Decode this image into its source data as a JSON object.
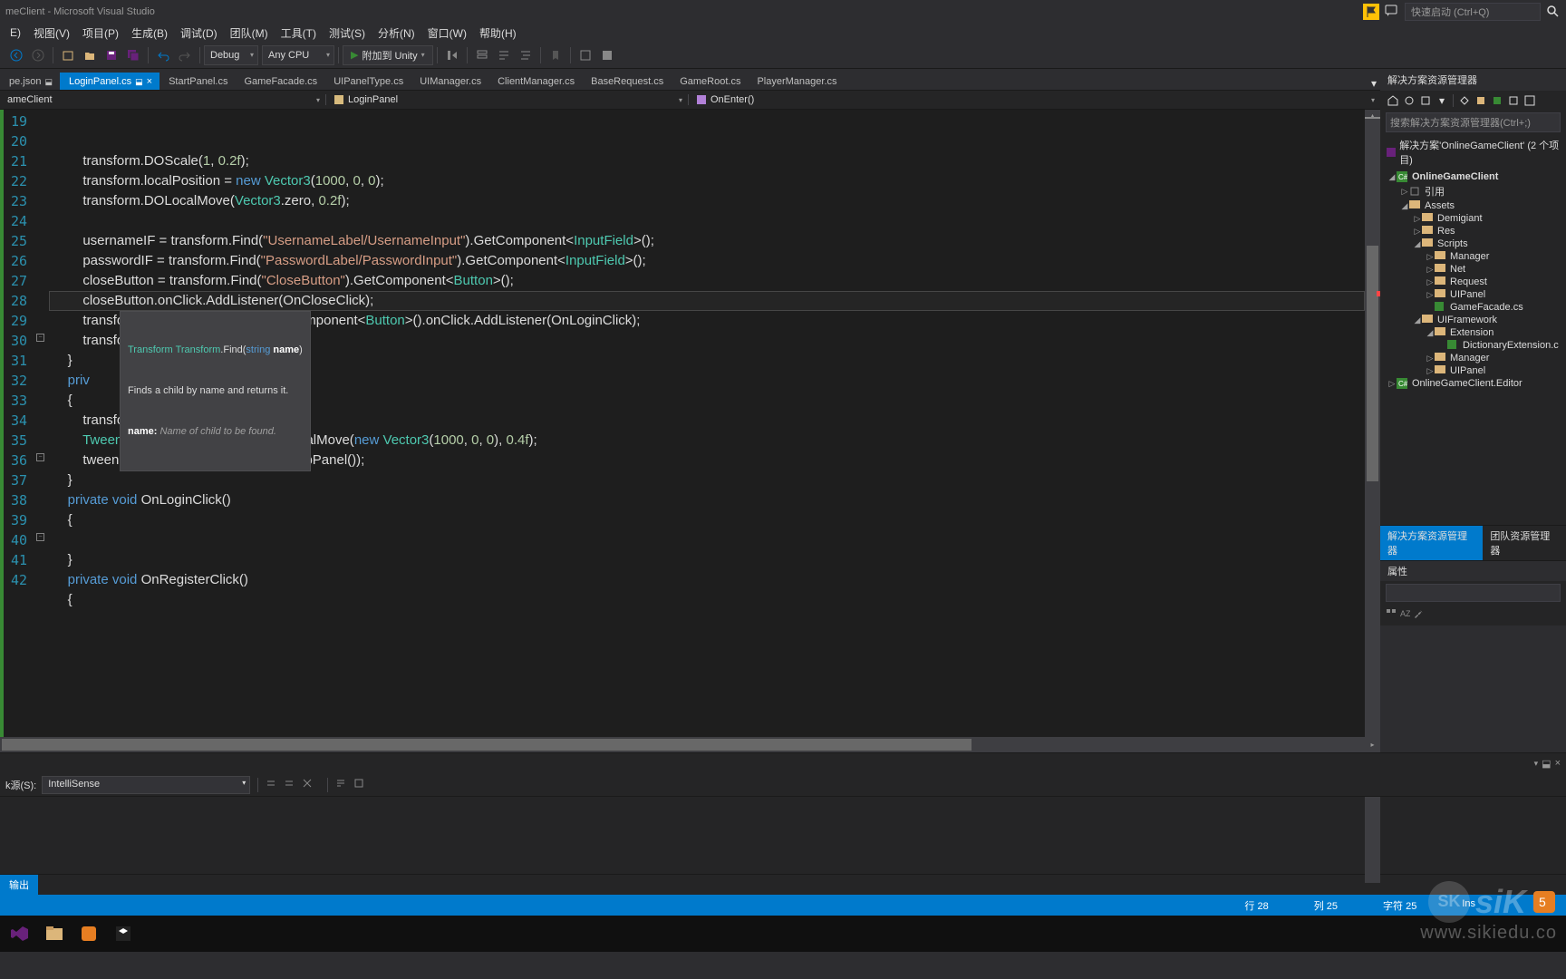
{
  "title": "meClient - Microsoft Visual Studio",
  "quickLaunch": "快速启动 (Ctrl+Q)",
  "menu": [
    "E)",
    "视图(V)",
    "项目(P)",
    "生成(B)",
    "调试(D)",
    "团队(M)",
    "工具(T)",
    "测试(S)",
    "分析(N)",
    "窗口(W)",
    "帮助(H)"
  ],
  "toolbar": {
    "debug": "Debug",
    "cpu": "Any CPU",
    "attach": "附加到 Unity"
  },
  "tabs": [
    {
      "label": "pe.json",
      "pinned": true,
      "active": false
    },
    {
      "label": "LoginPanel.cs",
      "pinned": true,
      "active": true
    },
    {
      "label": "StartPanel.cs",
      "active": false
    },
    {
      "label": "GameFacade.cs",
      "active": false
    },
    {
      "label": "UIPanelType.cs",
      "active": false
    },
    {
      "label": "UIManager.cs",
      "active": false
    },
    {
      "label": "ClientManager.cs",
      "active": false
    },
    {
      "label": "BaseRequest.cs",
      "active": false
    },
    {
      "label": "GameRoot.cs",
      "active": false
    },
    {
      "label": "PlayerManager.cs",
      "active": false
    }
  ],
  "navLeft": "ameClient",
  "navMid": "LoginPanel",
  "navRight": "OnEnter()",
  "lineStart": 19,
  "lineEnd": 42,
  "tooltip": {
    "sig_pre": "Transform",
    "sig_cls": "Transform",
    "sig_method": ".Find(",
    "sig_ptype": "string",
    "sig_pname": "name",
    "sig_post": ")",
    "desc": "Finds a child by name and returns it.",
    "pname": "name:",
    "pdesc": "Name of child to be found."
  },
  "solutionExplorer": {
    "title": "解决方案资源管理器",
    "search": "搜索解决方案资源管理器(Ctrl+;)",
    "solution": "解决方案'OnlineGameClient' (2 个项目)",
    "tree": [
      {
        "d": 0,
        "t": "proj",
        "l": "OnlineGameClient",
        "exp": true,
        "bold": true
      },
      {
        "d": 1,
        "t": "ref",
        "l": "引用",
        "exp": false
      },
      {
        "d": 1,
        "t": "folder",
        "l": "Assets",
        "exp": true
      },
      {
        "d": 2,
        "t": "folder",
        "l": "Demigiant",
        "exp": false
      },
      {
        "d": 2,
        "t": "folder",
        "l": "Res",
        "exp": false
      },
      {
        "d": 2,
        "t": "folder",
        "l": "Scripts",
        "exp": true
      },
      {
        "d": 3,
        "t": "folder",
        "l": "Manager",
        "exp": false
      },
      {
        "d": 3,
        "t": "folder",
        "l": "Net",
        "exp": false
      },
      {
        "d": 3,
        "t": "folder",
        "l": "Request",
        "exp": false
      },
      {
        "d": 3,
        "t": "folder",
        "l": "UIPanel",
        "exp": false
      },
      {
        "d": 3,
        "t": "cs",
        "l": "GameFacade.cs"
      },
      {
        "d": 2,
        "t": "folder",
        "l": "UIFramework",
        "exp": true
      },
      {
        "d": 3,
        "t": "folder",
        "l": "Extension",
        "exp": true
      },
      {
        "d": 4,
        "t": "cs",
        "l": "DictionaryExtension.c"
      },
      {
        "d": 3,
        "t": "folder",
        "l": "Manager",
        "exp": false
      },
      {
        "d": 3,
        "t": "folder",
        "l": "UIPanel",
        "exp": false
      },
      {
        "d": 0,
        "t": "proj",
        "l": "OnlineGameClient.Editor",
        "exp": false
      }
    ],
    "tabs": [
      "解决方案资源管理器",
      "团队资源管理器"
    ]
  },
  "properties": "属性",
  "output": {
    "sourceLabel": "k源(S):",
    "source": "IntelliSense",
    "tab": "输出"
  },
  "status": {
    "line": "行 28",
    "col": "列 25",
    "char": "字符 25",
    "ins": "Ins"
  },
  "watermark": {
    "brand": "SK",
    "text1": "siK",
    "url": "www.sikiedu.co"
  }
}
